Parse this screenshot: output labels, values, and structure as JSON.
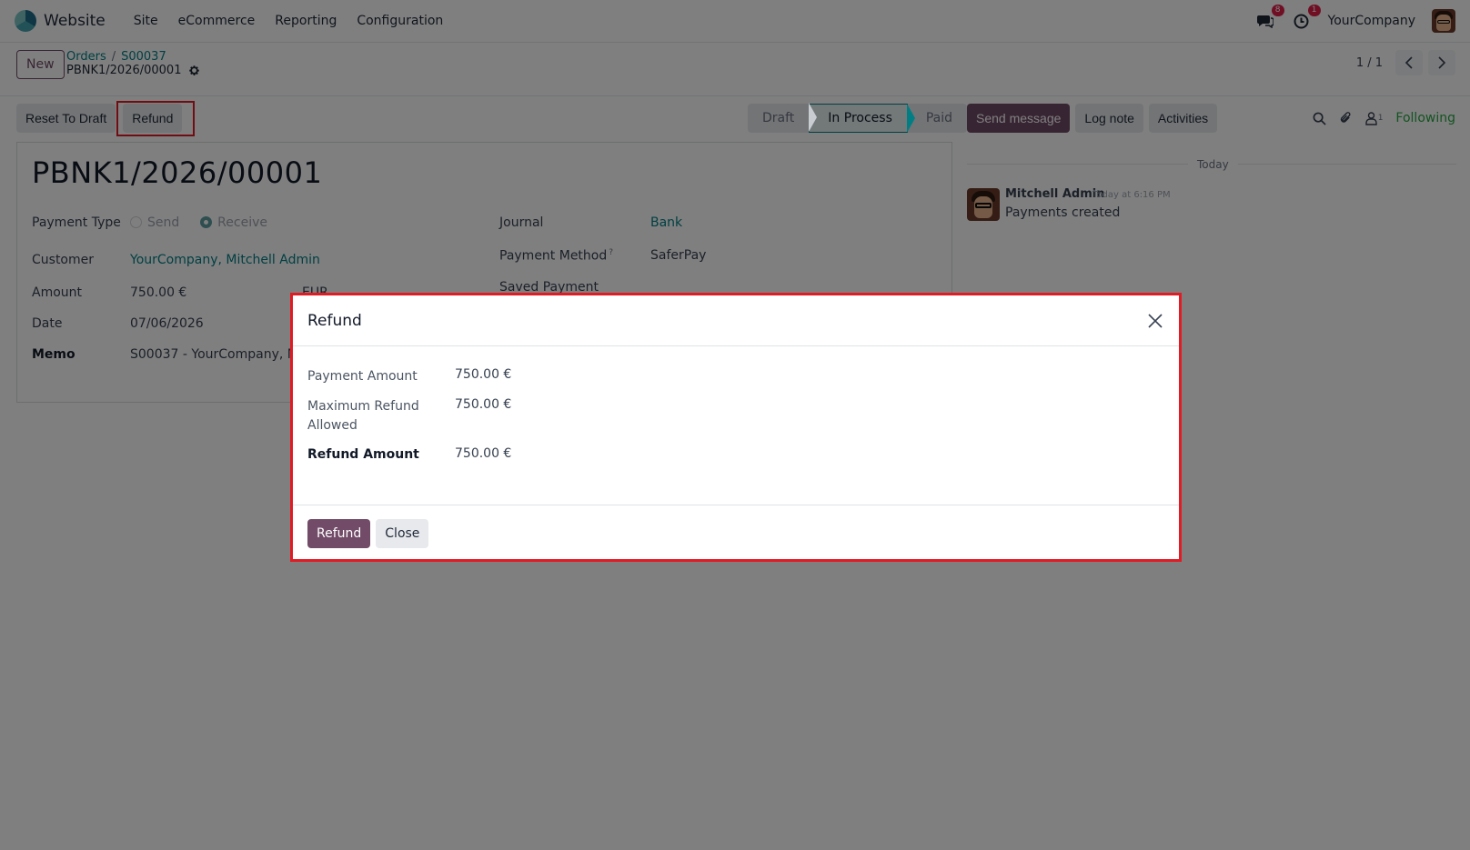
{
  "navbar": {
    "app_name": "Website",
    "menu": [
      "Site",
      "eCommerce",
      "Reporting",
      "Configuration"
    ],
    "messages_badge": "8",
    "activities_badge": "1",
    "company": "YourCompany"
  },
  "control_panel": {
    "new_label": "New",
    "breadcrumb": [
      "Orders",
      "S00037"
    ],
    "record_name": "PBNK1/2026/00001",
    "pager": "1 / 1"
  },
  "actions": {
    "reset_to_draft": "Reset To Draft",
    "refund": "Refund"
  },
  "status": {
    "stages": [
      "Draft",
      "In Process",
      "Paid"
    ],
    "active": "In Process"
  },
  "form": {
    "title": "PBNK1/2026/00001",
    "payment_type_label": "Payment Type",
    "payment_type_options": [
      "Send",
      "Receive"
    ],
    "payment_type_selected": "Receive",
    "customer_label": "Customer",
    "customer_value": "YourCompany, Mitchell Admin",
    "amount_label": "Amount",
    "amount_value": "750.00 €",
    "currency": "EUR",
    "date_label": "Date",
    "date_value": "07/06/2026",
    "memo_label": "Memo",
    "memo_value": "S00037 - YourCompany, Mitchell Admin",
    "journal_label": "Journal",
    "journal_value": "Bank",
    "payment_method_label": "Payment Method",
    "payment_method_help": "?",
    "payment_method_value": "SaferPay",
    "saved_payment_label": "Saved Payment"
  },
  "chatter": {
    "send_message": "Send message",
    "log_note": "Log note",
    "activities": "Activities",
    "followers_count": "1",
    "following": "Following",
    "date_separator": "Today",
    "messages": [
      {
        "author": "Mitchell Admin",
        "time": "Today at 6:16 PM",
        "body": "Payments created"
      }
    ]
  },
  "modal": {
    "title": "Refund",
    "payment_amount_label": "Payment Amount",
    "payment_amount_value": "750.00 €",
    "max_refund_label_line1": "Maximum Refund",
    "max_refund_label_line2": "Allowed",
    "max_refund_value": "750.00 €",
    "refund_amount_label": "Refund Amount",
    "refund_amount_value": "750.00 €",
    "refund_button": "Refund",
    "close_button": "Close"
  },
  "colors": {
    "brand_primary": "#714b67",
    "link": "#017e84",
    "highlight": "#e01b24",
    "following": "#28a745"
  },
  "icons": [
    "messages-icon",
    "activity-clock-icon",
    "gear-icon",
    "chevron-left-icon",
    "chevron-right-icon",
    "search-icon",
    "paperclip-icon",
    "user-follower-icon",
    "close-icon"
  ]
}
